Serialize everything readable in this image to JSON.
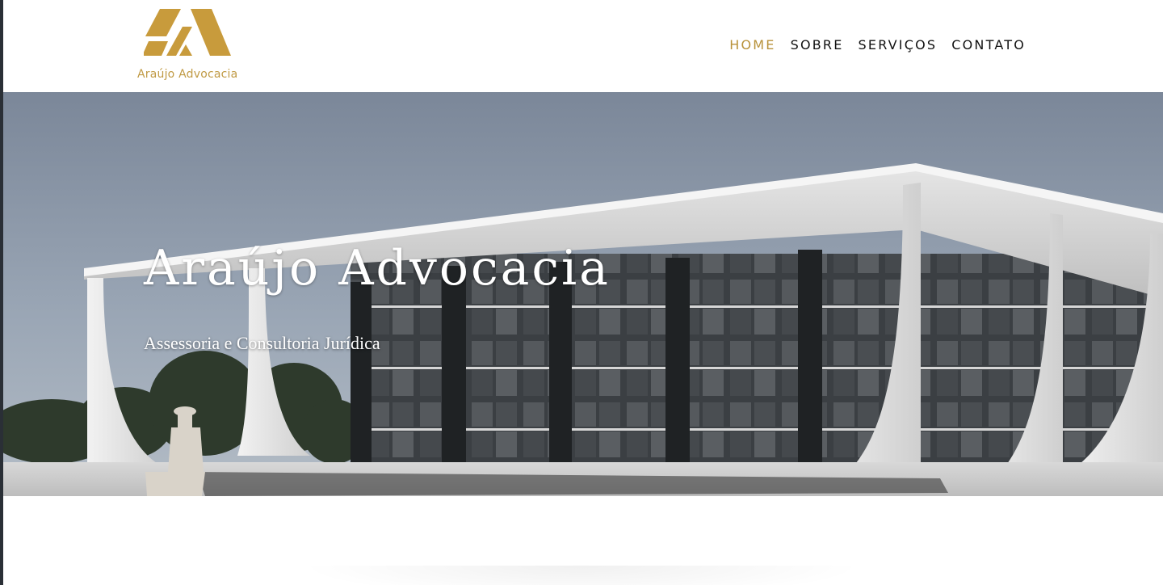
{
  "brand": {
    "name": "Araújo Advocacia",
    "logo_icon": "monogram-logo-icon",
    "accent_color": "#c09a44"
  },
  "nav": {
    "items": [
      {
        "label": "HOME",
        "active": true
      },
      {
        "label": "SOBRE",
        "active": false
      },
      {
        "label": "SERVIÇOS",
        "active": false
      },
      {
        "label": "CONTATO",
        "active": false
      }
    ],
    "active_color": "#b8923a",
    "text_color": "#111111"
  },
  "hero": {
    "title": "Araújo Advocacia",
    "subtitle": "Assessoria e Consultoria Jurídica",
    "background_image": "supreme-court-building-photo"
  }
}
